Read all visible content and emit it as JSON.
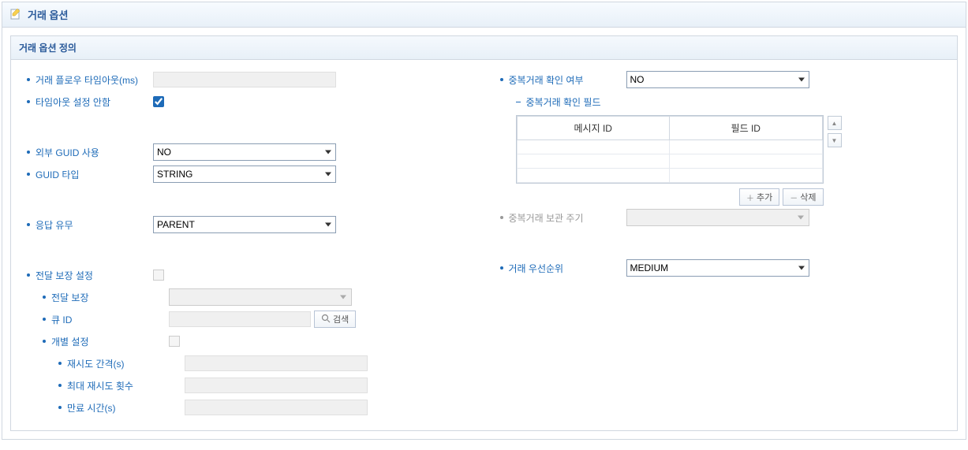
{
  "panel_title": "거래 옵션",
  "section_title": "거래 옵션 정의",
  "left": {
    "flow_timeout_label": "거래 플로우 타임아웃(ms)",
    "flow_timeout_value": "",
    "timeout_off_label": "타임아웃 설정 안함",
    "timeout_off_checked": true,
    "ext_guid_label": "외부 GUID 사용",
    "ext_guid_value": "NO",
    "guid_type_label": "GUID 타입",
    "guid_type_value": "STRING",
    "response_label": "응답 유무",
    "response_value": "PARENT",
    "delivery_set_label": "전달 보장 설정",
    "delivery_label": "전달 보장",
    "queue_label": "큐 ID",
    "search_btn": "검색",
    "indiv_label": "개별 설정",
    "retry_interval_label": "재시도 간격(s)",
    "max_retry_label": "최대 재시도 횟수",
    "expire_label": "만료 시간(s)"
  },
  "right": {
    "dup_check_label": "중복거래 확인 여부",
    "dup_check_value": "NO",
    "dup_field_label": "중복거래 확인 필드",
    "table_col_msg": "메시지 ID",
    "table_col_field": "필드 ID",
    "add_btn": "추가",
    "del_btn": "삭제",
    "dup_retain_label": "중복거래 보관 주기",
    "priority_label": "거래 우선순위",
    "priority_value": "MEDIUM"
  }
}
